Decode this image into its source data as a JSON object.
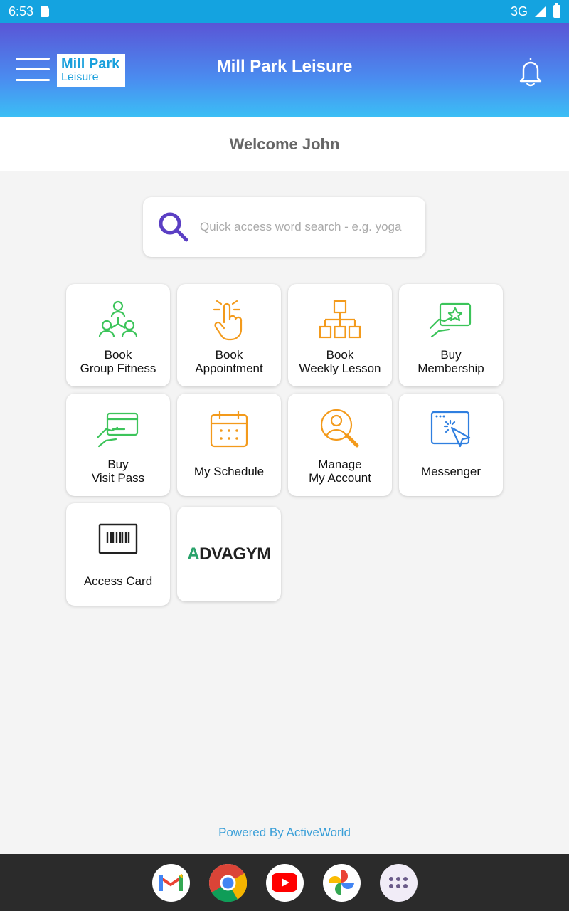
{
  "status_bar": {
    "time": "6:53",
    "network": "3G"
  },
  "header": {
    "logo_line1": "Mill Park",
    "logo_line2": "Leisure",
    "title": "Mill Park Leisure"
  },
  "welcome": "Welcome John",
  "search": {
    "placeholder": "Quick access word search - e.g. yoga"
  },
  "tiles": [
    {
      "label": "Book\nGroup Fitness",
      "icon": "group-fitness-icon",
      "color": "#3cc45a"
    },
    {
      "label": "Book\nAppointment",
      "icon": "hand-pointing-icon",
      "color": "#f39a1b"
    },
    {
      "label": "Book\nWeekly Lesson",
      "icon": "hierarchy-icon",
      "color": "#f39a1b"
    },
    {
      "label": "Buy\nMembership",
      "icon": "membership-card-icon",
      "color": "#3cc45a"
    },
    {
      "label": "Buy\nVisit Pass",
      "icon": "visit-pass-icon",
      "color": "#3cc45a"
    },
    {
      "label": "My Schedule",
      "icon": "calendar-icon",
      "color": "#f39a1b"
    },
    {
      "label": "Manage\nMy Account",
      "icon": "account-search-icon",
      "color": "#f39a1b"
    },
    {
      "label": "Messenger",
      "icon": "browser-click-icon",
      "color": "#2f7fe0"
    },
    {
      "label": "Access Card",
      "icon": "barcode-icon",
      "color": "#222222"
    }
  ],
  "advagym": {
    "first_letter": "A",
    "rest": "DVAGYM"
  },
  "footer": "Powered By ActiveWorld",
  "dock": [
    "gmail-icon",
    "chrome-icon",
    "youtube-icon",
    "photos-icon",
    "app-drawer-icon"
  ]
}
